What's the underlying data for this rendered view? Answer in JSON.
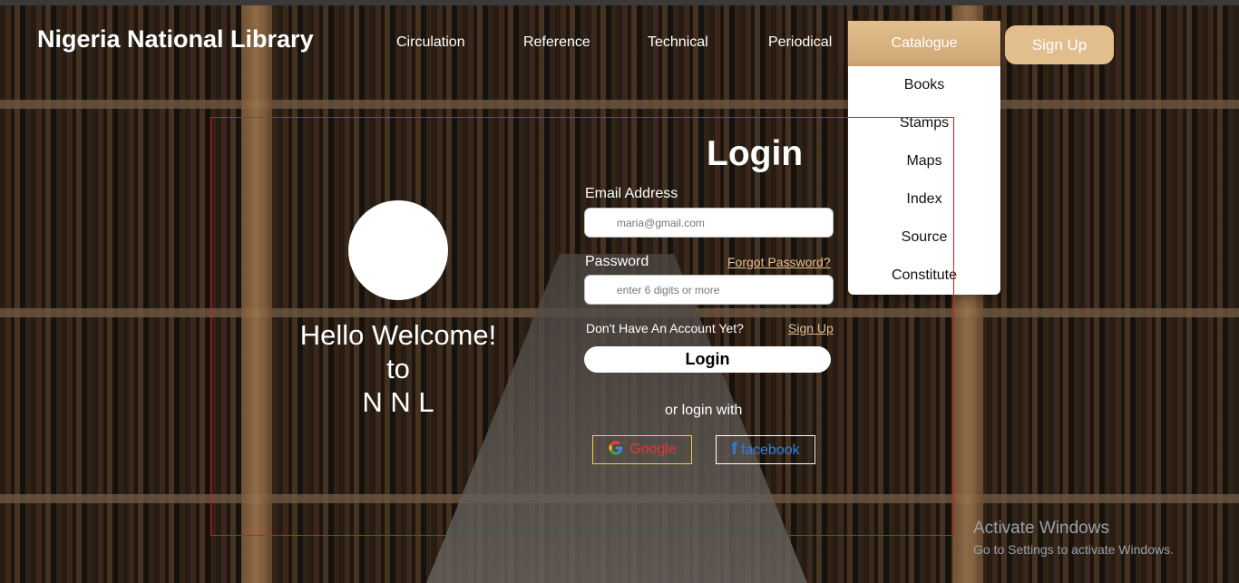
{
  "brand": {
    "title": "Nigeria National Library"
  },
  "nav": {
    "items": [
      "Circulation",
      "Reference",
      "Technical",
      "Periodical",
      "Catalogue"
    ],
    "signup": "Sign Up"
  },
  "dropdown": {
    "items": [
      "Books",
      "Stamps",
      "Maps",
      "Index",
      "Source",
      "Constitute"
    ]
  },
  "welcome": {
    "line1": "Hello Welcome!",
    "line2": "to",
    "line3": "N N L"
  },
  "login": {
    "title": "Login",
    "email_label": "Email Address",
    "email_placeholder": "maria@gmail.com",
    "password_label": "Password",
    "password_placeholder": "enter 6 digits or more",
    "forgot": "Forgot Password?",
    "no_account": "Don't Have An Account Yet?",
    "signup_link": "Sign Up",
    "button": "Login",
    "or_text": "or login with",
    "google": "Google",
    "facebook": "facebook"
  },
  "watermark": {
    "line1": "Activate Windows",
    "line2": "Go to Settings to activate Windows."
  },
  "colors": {
    "accent": "#e2be8e",
    "panel_border": "#e0161e",
    "google_text": "#e53935",
    "facebook_text": "#2f7fe8"
  },
  "icons": [
    "google-icon",
    "facebook-icon"
  ]
}
